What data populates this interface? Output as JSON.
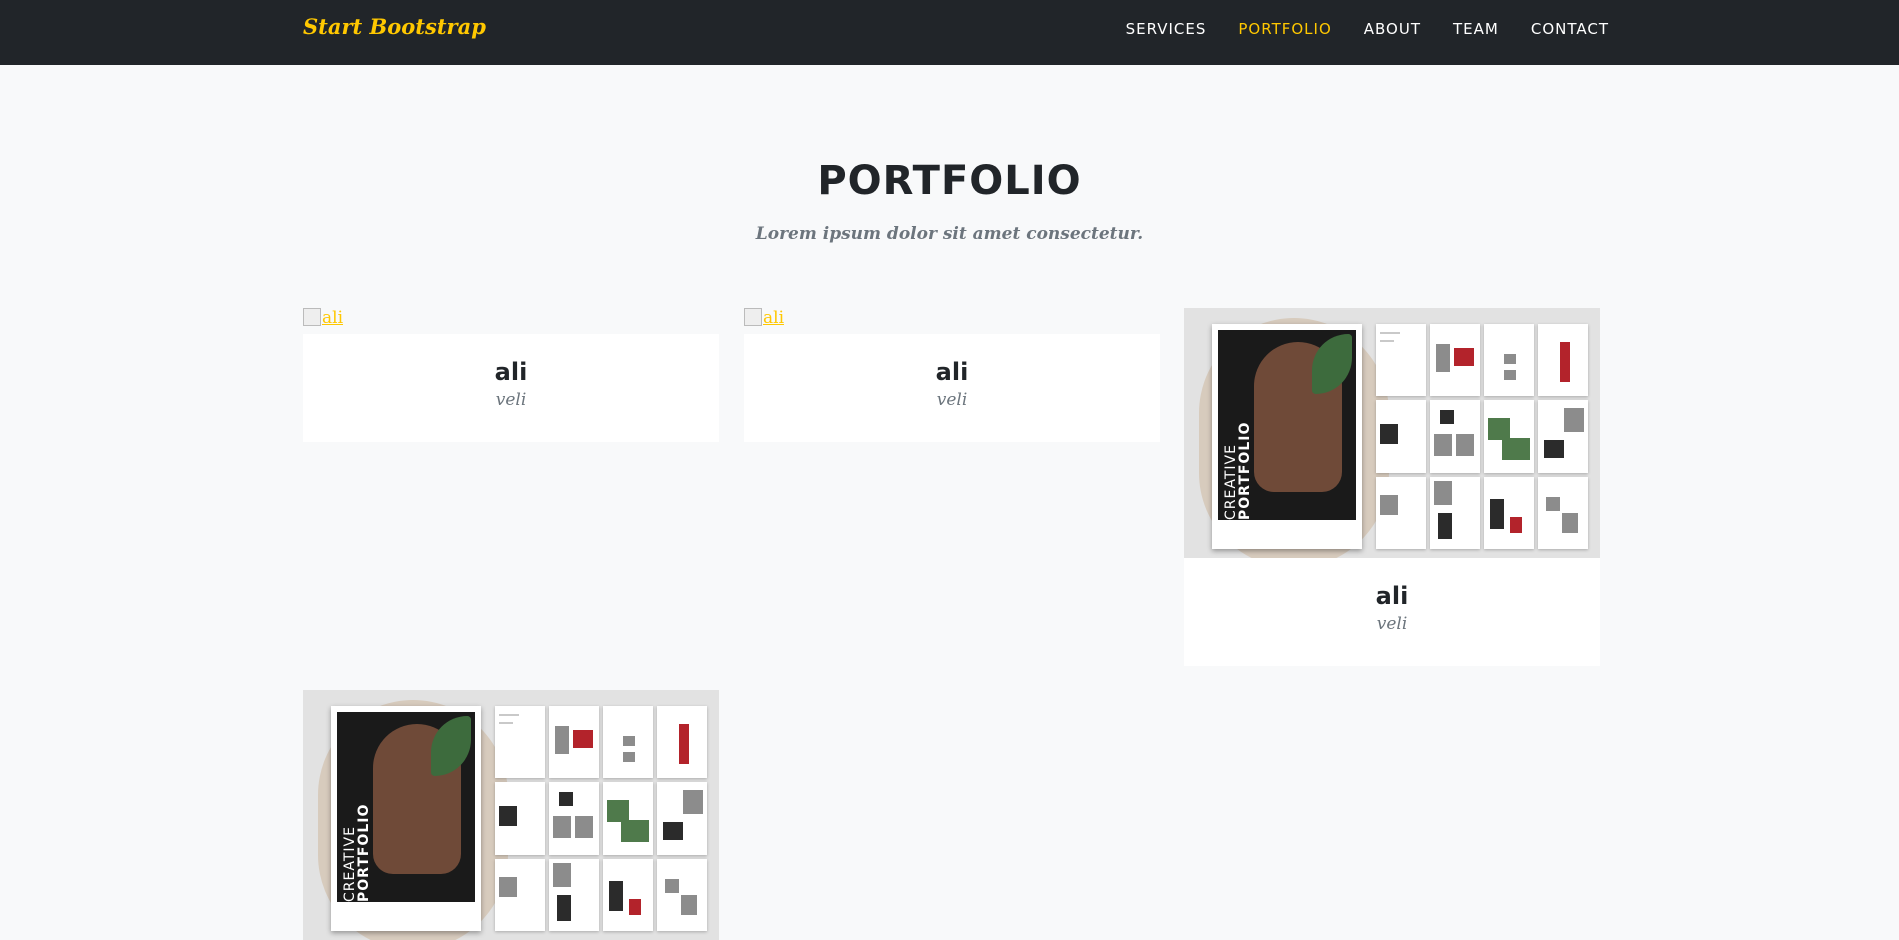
{
  "navbar": {
    "brand": "Start Bootstrap",
    "links": [
      {
        "label": "SERVICES",
        "active": false
      },
      {
        "label": "PORTFOLIO",
        "active": true
      },
      {
        "label": "ABOUT",
        "active": false
      },
      {
        "label": "TEAM",
        "active": false
      },
      {
        "label": "CONTACT",
        "active": false
      }
    ]
  },
  "portfolio": {
    "heading": "PORTFOLIO",
    "subheading": "Lorem ipsum dolor sit amet consectetur.",
    "items": [
      {
        "image_alt": "ali",
        "image_loaded": false,
        "heading": "ali",
        "subheading": "veli"
      },
      {
        "image_alt": "ali",
        "image_loaded": false,
        "heading": "ali",
        "subheading": "veli"
      },
      {
        "image_alt": "ali",
        "image_loaded": true,
        "heading": "ali",
        "subheading": "veli",
        "mockup": {
          "cover_top": "CREATIVE",
          "cover_bottom": "PORTFOLIO"
        }
      },
      {
        "image_alt": "ali",
        "image_loaded": true,
        "mockup": {
          "cover_top": "CREATIVE",
          "cover_bottom": "PORTFOLIO"
        }
      }
    ]
  },
  "colors": {
    "accent": "#ffc800",
    "navbar_bg": "#212529",
    "page_bg": "#f8f9fa",
    "muted_text": "#6c757d"
  }
}
